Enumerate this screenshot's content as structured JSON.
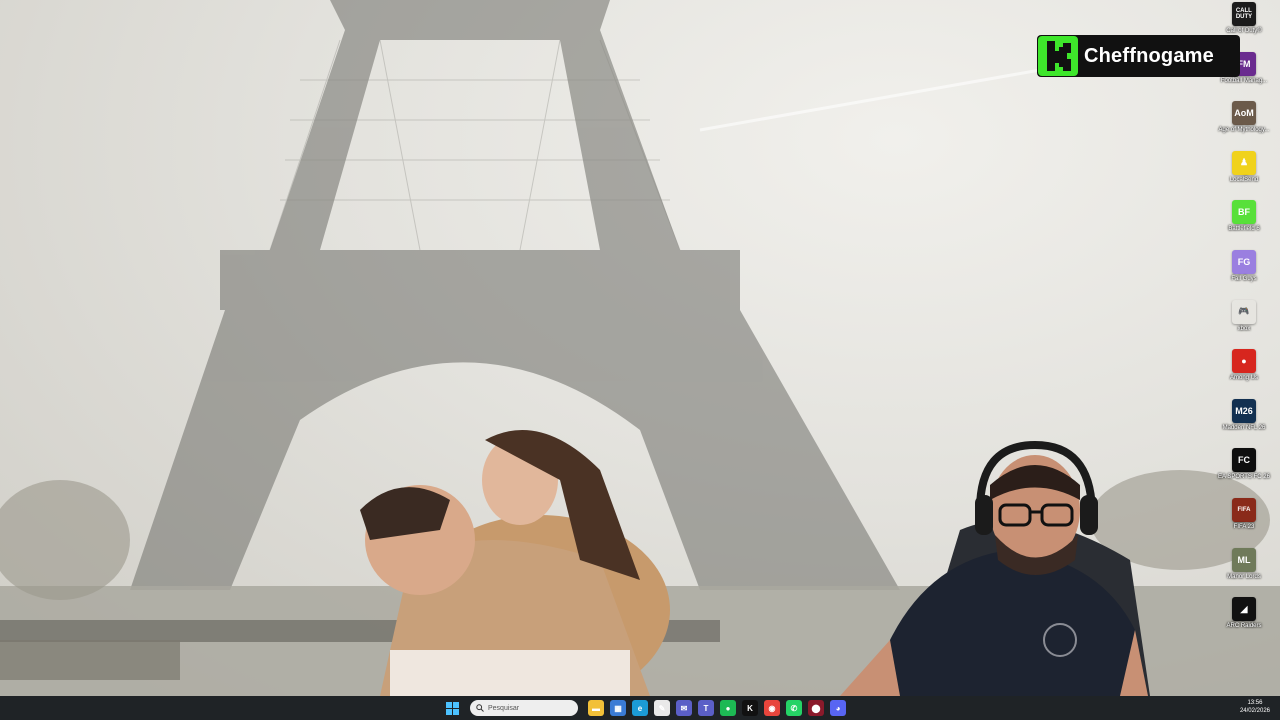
{
  "desktop": {
    "icons": [
      {
        "name": "call-of-duty-icon",
        "label": "Call of Duty®",
        "glyph": "CALL\nDUTY",
        "bg": "#1b1b1b"
      },
      {
        "name": "football-manager-icon",
        "label": "Football Manag...",
        "glyph": "FM",
        "bg": "#6a2b8f"
      },
      {
        "name": "age-of-mythology-icon",
        "label": "Age of Mythology...",
        "glyph": "AoM",
        "bg": "#6b5a4a"
      },
      {
        "name": "localsend-icon",
        "label": "LocalSend",
        "glyph": "♟",
        "bg": "#f0d21c"
      },
      {
        "name": "battlefield-6-icon",
        "label": "Battlefield 6",
        "glyph": "BF",
        "bg": "#58e03a"
      },
      {
        "name": "fall-guys-icon",
        "label": "Fall Guys",
        "glyph": "FG",
        "bg": "#9a7fe0"
      },
      {
        "name": "xbox-gamepad-icon",
        "label": "xbox",
        "glyph": "🎮",
        "bg": "transparent"
      },
      {
        "name": "among-us-icon",
        "label": "Among Us",
        "glyph": "●",
        "bg": "#d7261e"
      },
      {
        "name": "madden-nfl-26-icon",
        "label": "Madden NFL 26",
        "glyph": "M26",
        "bg": "#123051"
      },
      {
        "name": "ea-sports-fc-26-icon",
        "label": "EA SPORTS FC 26",
        "glyph": "FC",
        "bg": "#0e0e0e"
      },
      {
        "name": "fifa-23-icon",
        "label": "FIFA 23",
        "glyph": "FIFA",
        "bg": "#8a2a1a"
      },
      {
        "name": "manor-lords-icon",
        "label": "Manor Lords",
        "glyph": "ML",
        "bg": "#6f7a5a"
      },
      {
        "name": "arc-raiders-icon",
        "label": "ARC Raiders",
        "glyph": "◢",
        "bg": "#111"
      }
    ]
  },
  "overlay": {
    "brand_name": "Cheffnogame",
    "brand_color": "#3ee62b"
  },
  "taskbar": {
    "search_placeholder": "Pesquisar",
    "apps": [
      {
        "name": "file-explorer-icon",
        "glyph": "▬",
        "bg": "#f2c038"
      },
      {
        "name": "microsoft-store-icon",
        "glyph": "▦",
        "bg": "#3a7bd5"
      },
      {
        "name": "edge-browser-icon",
        "glyph": "e",
        "bg": "#1c9bd6"
      },
      {
        "name": "notepad-icon",
        "glyph": "✎",
        "bg": "#e9e9e9"
      },
      {
        "name": "chat-icon",
        "glyph": "✉",
        "bg": "#5b5fc7"
      },
      {
        "name": "teams-icon",
        "glyph": "T",
        "bg": "#5b5fc7"
      },
      {
        "name": "spotify-icon",
        "glyph": "●",
        "bg": "#1db954"
      },
      {
        "name": "kick-icon",
        "glyph": "K",
        "bg": "#111"
      },
      {
        "name": "chrome-icon",
        "glyph": "◉",
        "bg": "#e8453c"
      },
      {
        "name": "whatsapp-icon",
        "glyph": "✆",
        "bg": "#25d366"
      },
      {
        "name": "obs-record-icon",
        "glyph": "⬤",
        "bg": "#8b1a2b"
      },
      {
        "name": "discord-icon",
        "glyph": "◕",
        "bg": "#5865f2"
      }
    ],
    "time": "13:56",
    "date": "24/02/2026"
  }
}
